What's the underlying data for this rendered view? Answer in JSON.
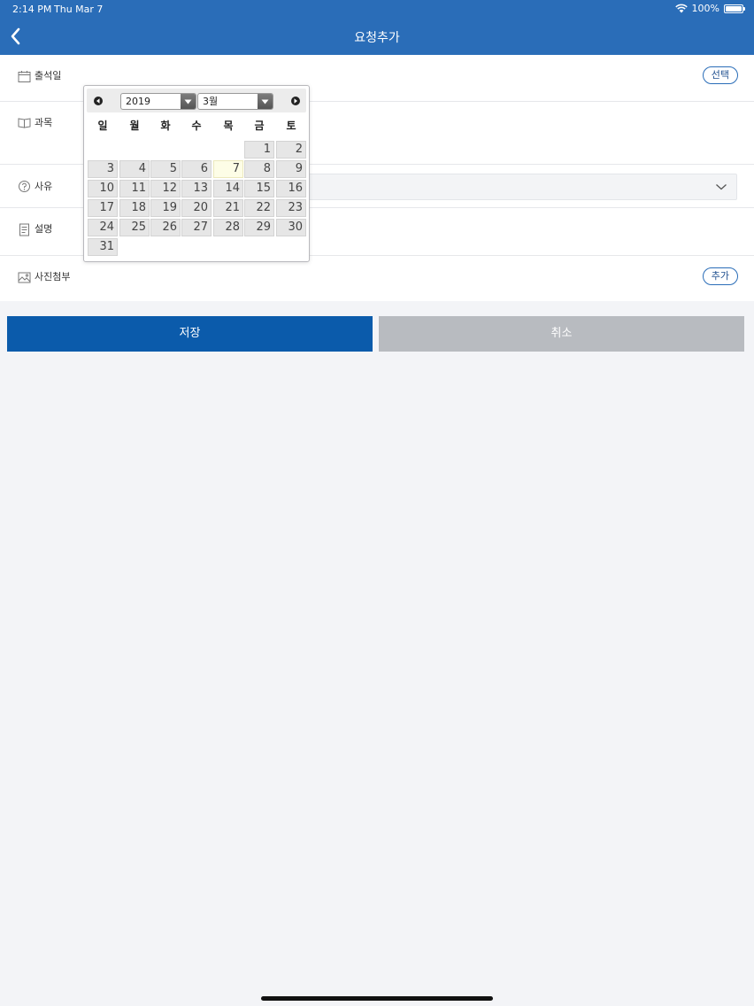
{
  "status_bar": {
    "time": "2:14 PM",
    "date": "Thu Mar 7",
    "battery": "100%"
  },
  "nav": {
    "title": "요청추가",
    "back_icon": "chevron-left-icon"
  },
  "form": {
    "attendance_date": {
      "label": "출석일",
      "button": "선택"
    },
    "subject": {
      "label": "과목"
    },
    "reason": {
      "label": "사유"
    },
    "description": {
      "label": "설명"
    },
    "photo": {
      "label": "사진첨부",
      "button": "추가"
    }
  },
  "buttons": {
    "save": "저장",
    "cancel": "취소"
  },
  "datepicker": {
    "year": "2019",
    "month": "3월",
    "weekdays": [
      "일",
      "월",
      "화",
      "수",
      "목",
      "금",
      "토"
    ],
    "days": [
      "1",
      "2",
      "3",
      "4",
      "5",
      "6",
      "7",
      "8",
      "9",
      "10",
      "11",
      "12",
      "13",
      "14",
      "15",
      "16",
      "17",
      "18",
      "19",
      "20",
      "21",
      "22",
      "23",
      "24",
      "25",
      "26",
      "27",
      "28",
      "29",
      "30",
      "31"
    ],
    "highlighted_day": "7"
  },
  "colors": {
    "nav": "#2a6db8",
    "save": "#0b5bab",
    "cancel": "#b8bbc0",
    "pill_border": "#2a6db8"
  }
}
